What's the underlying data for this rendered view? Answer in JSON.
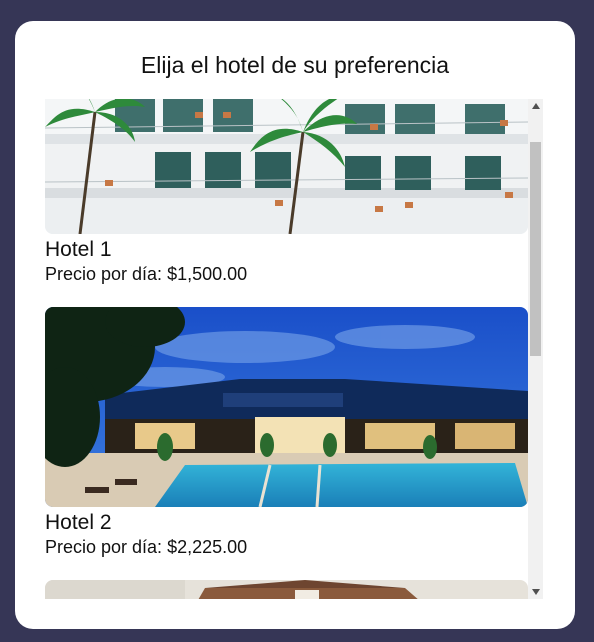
{
  "header": {
    "title": "Elija el hotel de su preferencia"
  },
  "hotels": [
    {
      "name": "Hotel 1",
      "price_label": "Precio por día: $1,500.00"
    },
    {
      "name": "Hotel 2",
      "price_label": "Precio por día: $2,225.00"
    }
  ],
  "colors": {
    "page_background": "#363656",
    "card_background": "#ffffff",
    "scroll_track": "#f1f1f1",
    "scroll_thumb": "#c1c1c1"
  },
  "icons": {
    "scroll_up": "triangle-up-icon",
    "scroll_down": "triangle-down-icon"
  }
}
